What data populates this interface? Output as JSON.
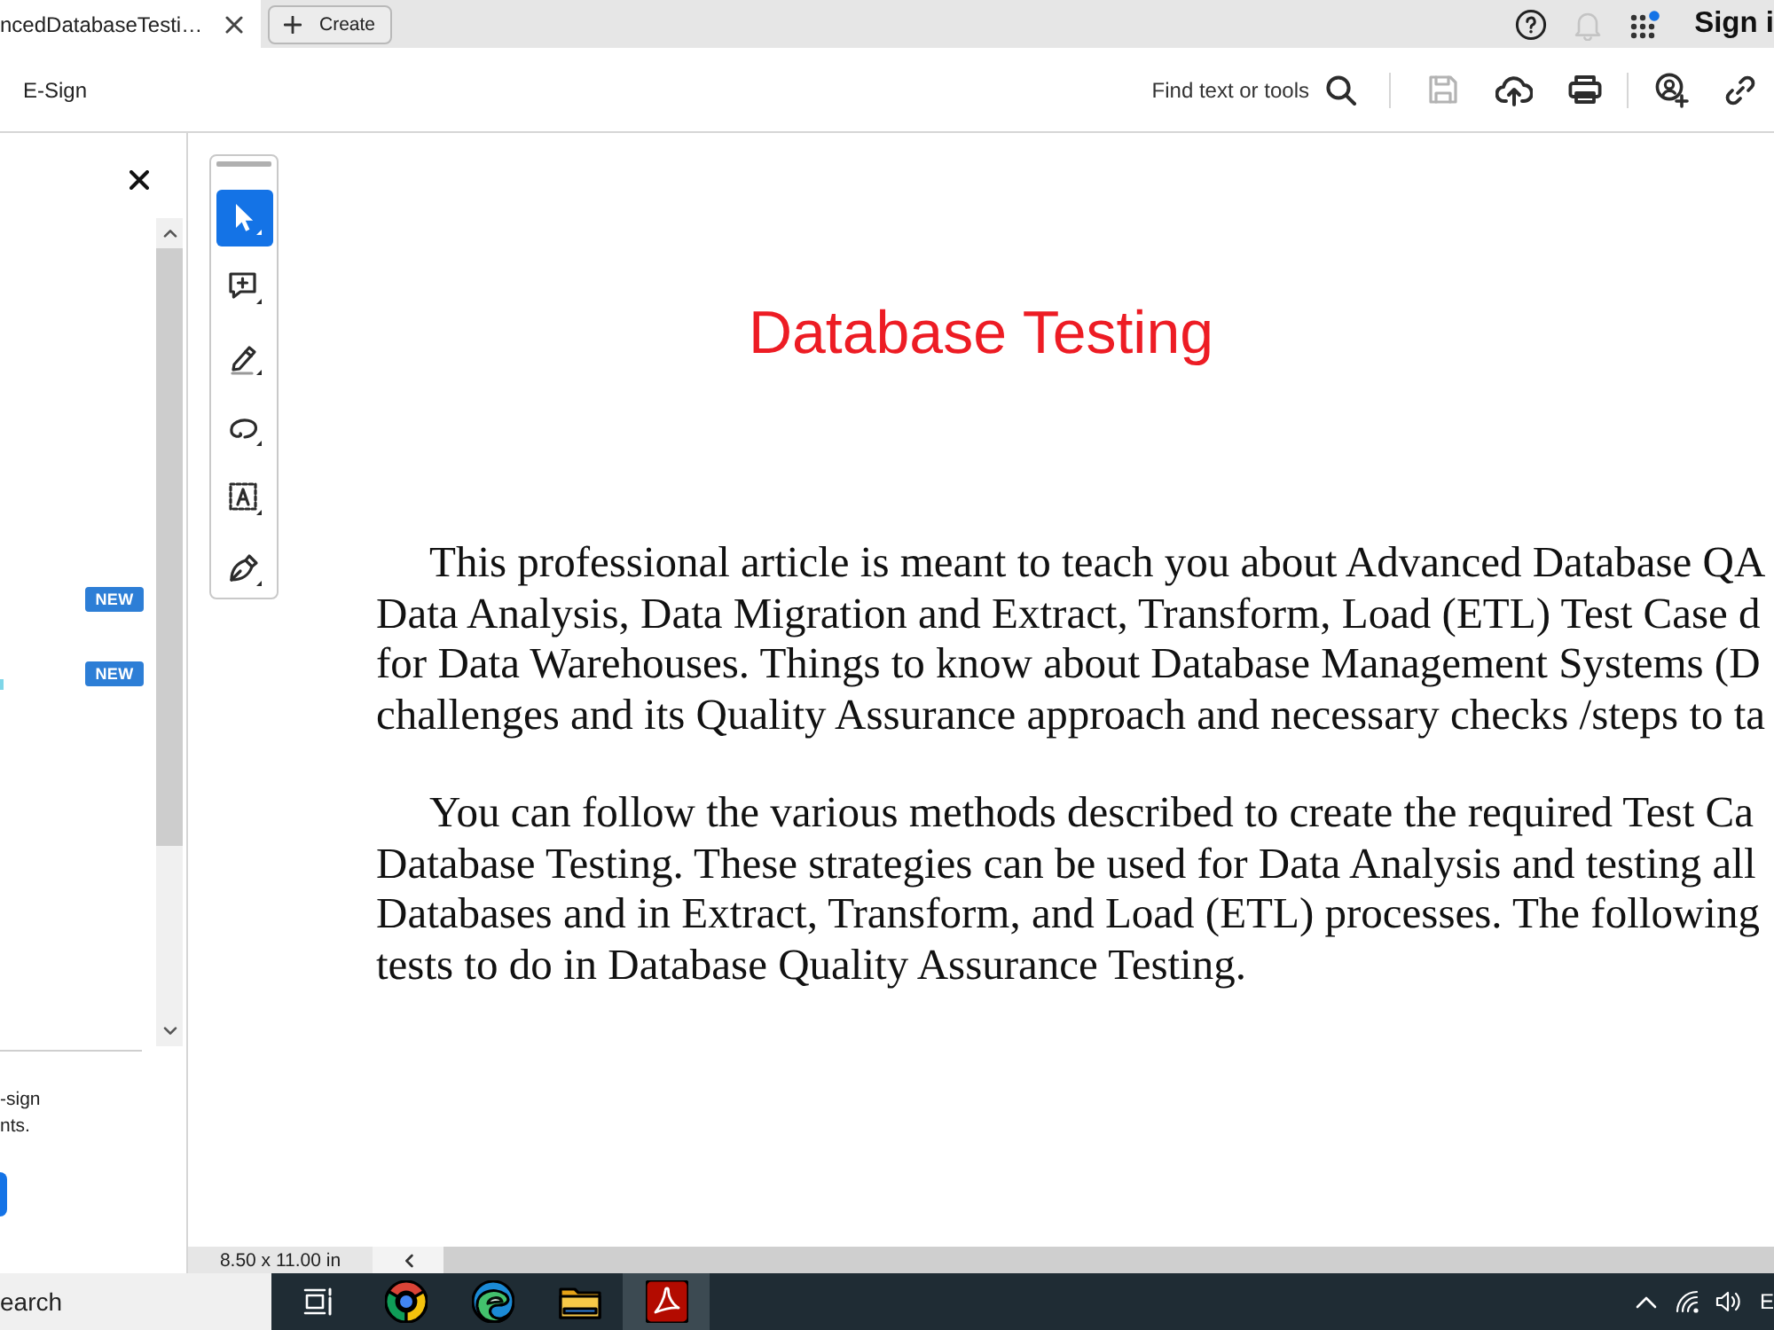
{
  "tabs": [
    {
      "title": "ncedDatabaseTesti…",
      "selected": true
    }
  ],
  "create_button": "Create",
  "header": {
    "notifications": {
      "disabled": true
    },
    "sign_in": "Sign i"
  },
  "toolbar": {
    "menu_item": "E-Sign",
    "search_label": "Find text or tools",
    "save": {
      "disabled": true
    }
  },
  "side_panel": {
    "badges": [
      "NEW",
      "NEW"
    ],
    "footer_lines": [
      "-sign",
      "nts."
    ]
  },
  "tool_palette": [
    {
      "kind": "select",
      "selected": true
    },
    {
      "kind": "comment",
      "selected": false
    },
    {
      "kind": "highlight",
      "selected": false
    },
    {
      "kind": "draw",
      "selected": false
    },
    {
      "kind": "text_select",
      "selected": false
    },
    {
      "kind": "sign",
      "selected": false
    }
  ],
  "document": {
    "title": "Database Testing",
    "paragraphs": [
      {
        "lines": [
          "This professional article is meant to teach you about Advanced Database QA",
          "Data Analysis, Data Migration and Extract, Transform, Load (ETL) Test Case d",
          "for Data Warehouses. Things to know about Database Management Systems (D",
          "challenges and its Quality Assurance approach and necessary checks /steps to ta"
        ]
      },
      {
        "lines": [
          "You can follow the various methods described to create the required Test Ca",
          "Database Testing. These strategies can be used for Data Analysis and testing all",
          "Databases and in Extract, Transform, and Load (ETL) processes. The following",
          "tests to do in Database Quality Assurance Testing."
        ]
      }
    ]
  },
  "status_bar": {
    "page_size": "8.50 x 11.00 in"
  },
  "taskbar": {
    "search": "earch",
    "apps": [
      {
        "kind": "task_view",
        "selected": false
      },
      {
        "kind": "browser",
        "selected": false
      },
      {
        "kind": "browser_alt",
        "selected": false
      },
      {
        "kind": "folder",
        "selected": false
      },
      {
        "kind": "pdf_reader",
        "selected": true
      }
    ],
    "language": "E"
  }
}
